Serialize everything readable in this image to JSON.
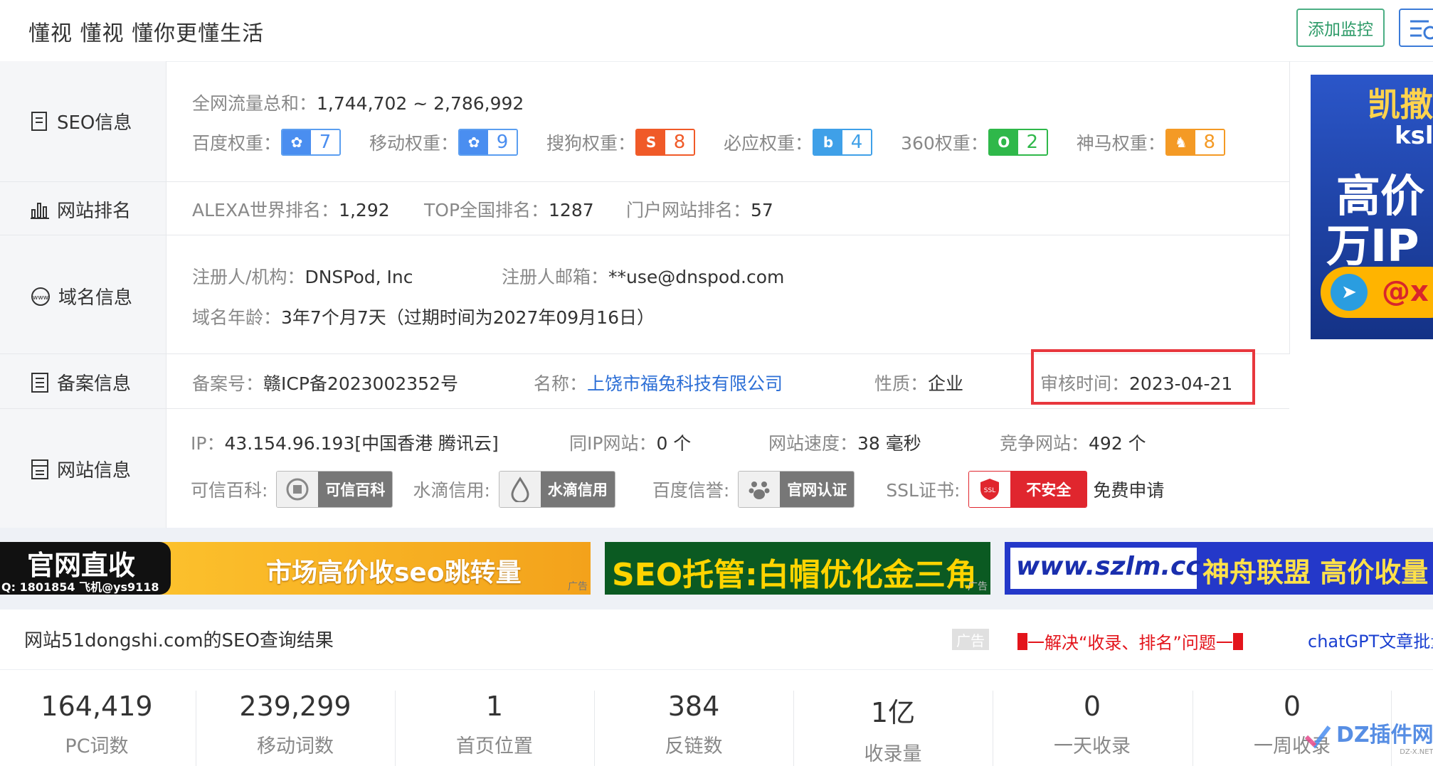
{
  "header": {
    "site_title": "懂视 懂视 懂你更懂生活",
    "add_monitor_label": "添加监控"
  },
  "seo": {
    "label": "SEO信息",
    "traffic_label": "全网流量总和：",
    "traffic_value": "1,744,702 ~ 2,786,992",
    "weights": [
      {
        "label": "百度权重：",
        "value": "7",
        "color": "#4a8ef0"
      },
      {
        "label": "移动权重：",
        "value": "9",
        "color": "#4a8ef0"
      },
      {
        "label": "搜狗权重：",
        "value": "8",
        "color": "#f05a28"
      },
      {
        "label": "必应权重：",
        "value": "4",
        "color": "#3fa0e8"
      },
      {
        "label": "360权重：",
        "value": "2",
        "color": "#2fb84a"
      },
      {
        "label": "神马权重：",
        "value": "8",
        "color": "#f49a25"
      }
    ]
  },
  "ranking": {
    "label": "网站排名",
    "alexa_label": "ALEXA世界排名：",
    "alexa_value": "1,292",
    "top_label": "TOP全国排名：",
    "top_value": "1287",
    "portal_label": "门户网站排名：",
    "portal_value": "57"
  },
  "domain": {
    "label": "域名信息",
    "registrant_label": "注册人/机构：",
    "registrant_value": "DNSPod, Inc",
    "email_label": "注册人邮箱：",
    "email_value": "**use@dnspod.com",
    "age_label": "域名年龄：",
    "age_value": "3年7个月7天（过期时间为2027年09月16日）"
  },
  "icp": {
    "label": "备案信息",
    "number_label": "备案号：",
    "number_value": "赣ICP备2023002352号",
    "name_label": "名称：",
    "name_value": "上饶市福兔科技有限公司",
    "type_label": "性质：",
    "type_value": "企业",
    "review_label": "审核时间：",
    "review_value": "2023-04-21"
  },
  "site": {
    "label": "网站信息",
    "ip_label": "IP：",
    "ip_value": "43.154.96.193[中国香港 腾讯云]",
    "same_ip_label": "同IP网站：",
    "same_ip_value": "0 个",
    "speed_label": "网站速度：",
    "speed_value": "38 毫秒",
    "competitor_label": "竞争网站：",
    "competitor_value": "492 个",
    "kexin_label": "可信百科:",
    "kexin_badge": "可信百科",
    "shuidi_label": "水滴信用:",
    "shuidi_badge": "水滴信用",
    "baidu_label": "百度信誉:",
    "baidu_badge": "官网认证",
    "ssl_label": "SSL证书:",
    "ssl_badge": "不安全",
    "ssl_apply": "免费申请"
  },
  "ads": {
    "ad1_left_title": "官网直收",
    "ad1_left_sub": "Q: 1801854 飞机@ys9118",
    "ad1_text": "市场高价收seo跳转量",
    "ad1_tag": "广告",
    "ad2_text": "SEO托管:白帽优化金三角",
    "ad2_tag": "广告",
    "ad3_url": "www.szlm.cc",
    "ad3_text": "神舟联盟 高价收量",
    "right_ad_line1": "凯撒",
    "right_ad_line2": "ksl",
    "right_ad_line3": "高价",
    "right_ad_line4": "万IP",
    "right_ad_contact": "@x"
  },
  "result": {
    "title": "网站51dongshi.com的SEO查询结果",
    "ad_tag": "广告",
    "link1": "一解决“收录、排名”问题一",
    "link2": "chatGPT文章批量"
  },
  "stats": [
    {
      "value": "164,419",
      "name": "PC词数"
    },
    {
      "value": "239,299",
      "name": "移动词数"
    },
    {
      "value": "1",
      "name": "首页位置"
    },
    {
      "value": "384",
      "name": "反链数"
    },
    {
      "value": "1亿",
      "name": "收录量"
    },
    {
      "value": "0",
      "name": "一天收录"
    },
    {
      "value": "0",
      "name": "一周收录"
    }
  ],
  "watermark": {
    "text": "DZ插件网",
    "sub": "DZ-X.NET"
  }
}
